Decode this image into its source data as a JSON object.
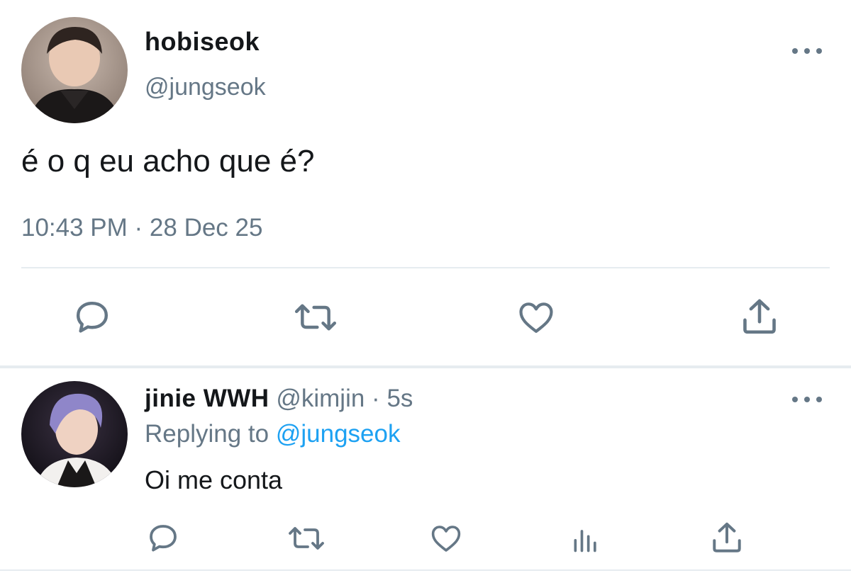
{
  "main_tweet": {
    "display_name": "hobiseok",
    "handle": "@jungseok",
    "text": "é o q eu acho que é?",
    "timestamp": "10:43 PM · 28 Dec 25",
    "icons": {
      "reply": "reply-icon",
      "retweet": "retweet-icon",
      "like": "heart-icon",
      "share": "share-icon",
      "more": "more-icon"
    }
  },
  "reply_tweet": {
    "display_name": "jinie WWH",
    "handle": "@kimjin",
    "separator": "·",
    "time": "5s",
    "replying_label": "Replying to",
    "replying_target": "@jungseok",
    "text": "Oi me conta",
    "icons": {
      "reply": "reply-icon",
      "retweet": "retweet-icon",
      "like": "heart-icon",
      "stats": "stats-icon",
      "share": "share-icon",
      "more": "more-icon"
    }
  },
  "colors": {
    "text_primary": "#14171a",
    "text_secondary": "#657786",
    "link": "#1da1f2",
    "divider": "#e6ecf0"
  }
}
